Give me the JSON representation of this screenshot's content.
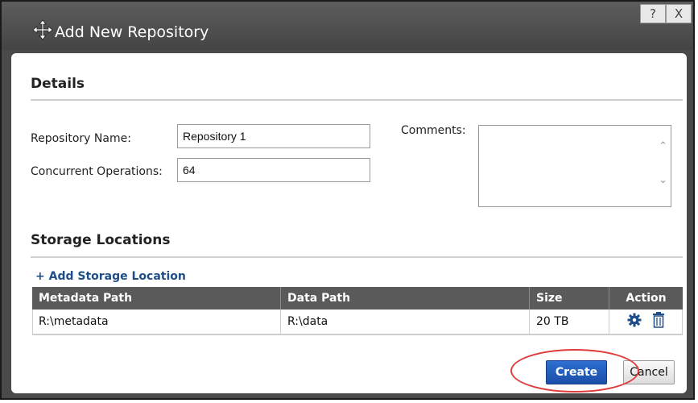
{
  "dialog": {
    "title": "Add New Repository",
    "help_label": "?",
    "close_label": "X"
  },
  "details": {
    "title": "Details",
    "repo_name_label": "Repository Name:",
    "repo_name_value": "Repository 1",
    "concurrent_label": "Concurrent Operations:",
    "concurrent_value": "64",
    "comments_label": "Comments:",
    "comments_value": ""
  },
  "storage": {
    "title": "Storage Locations",
    "add_link": "+ Add Storage Location",
    "columns": [
      "Metadata Path",
      "Data Path",
      "Size",
      "Action"
    ],
    "rows": [
      {
        "metadata_path": "R:\\metadata",
        "data_path": "R:\\data",
        "size": "20 TB"
      }
    ]
  },
  "footer": {
    "create_label": "Create",
    "cancel_label": "Cancel"
  },
  "icons": {
    "move": "move-icon",
    "settings": "gear-icon",
    "delete": "trash-icon"
  },
  "colors": {
    "accent": "#1e4e8a",
    "primary_button": "#2d6fd0",
    "highlight": "#e03b3b",
    "titlebar": "#4a4a4a"
  }
}
